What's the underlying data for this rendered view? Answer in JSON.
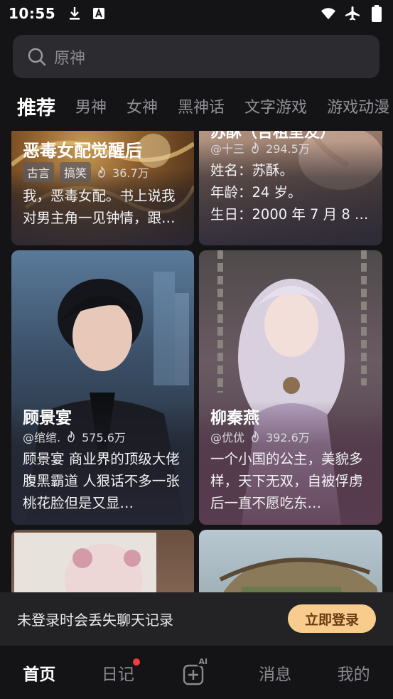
{
  "status": {
    "time": "10:55",
    "download_icon": "download-icon",
    "a_icon": "a-box-icon",
    "wifi_icon": "wifi-icon",
    "airplane_icon": "airplane-icon",
    "battery_icon": "battery-icon"
  },
  "search": {
    "placeholder": "原神"
  },
  "tabs": [
    {
      "label": "推荐"
    },
    {
      "label": "男神"
    },
    {
      "label": "女神"
    },
    {
      "label": "黑神话"
    },
    {
      "label": "文字游戏"
    },
    {
      "label": "游戏动漫"
    }
  ],
  "cards": [
    {
      "name": "恶毒女配觉醒后",
      "tags": [
        "古言",
        "搞笑"
      ],
      "heat": "36.7万",
      "desc": "我，恶毒女配。书上说我对男主角一见钟情，跟…"
    },
    {
      "name": "苏酥（合租室友）",
      "author": "@十三",
      "heat": "294.5万",
      "desc_lines": [
        "姓名：苏酥。",
        "年龄：24 岁。",
        "生日：2000 年 7 月 8 …"
      ]
    },
    {
      "name": "顾景宴",
      "author": "@绾绾.",
      "heat": "575.6万",
      "desc": "顾景宴 商业界的顶级大佬 腹黑霸道 人狠话不多一张桃花脸但是又显…"
    },
    {
      "name": "柳秦燕",
      "author": "@优优",
      "heat": "392.6万",
      "desc": "一个小国的公主，美貌多样，天下无双，自被俘虏后一直不愿吃东…"
    }
  ],
  "login_banner": {
    "text": "未登录时会丢失聊天记录",
    "button": "立即登录"
  },
  "nav": [
    {
      "label": "首页"
    },
    {
      "label": "日记"
    },
    {
      "label": "AI"
    },
    {
      "label": "消息"
    },
    {
      "label": "我的"
    }
  ],
  "colors": {
    "background": "#141416",
    "accent": "#f8cc8c",
    "badge": "#f23c3c"
  }
}
